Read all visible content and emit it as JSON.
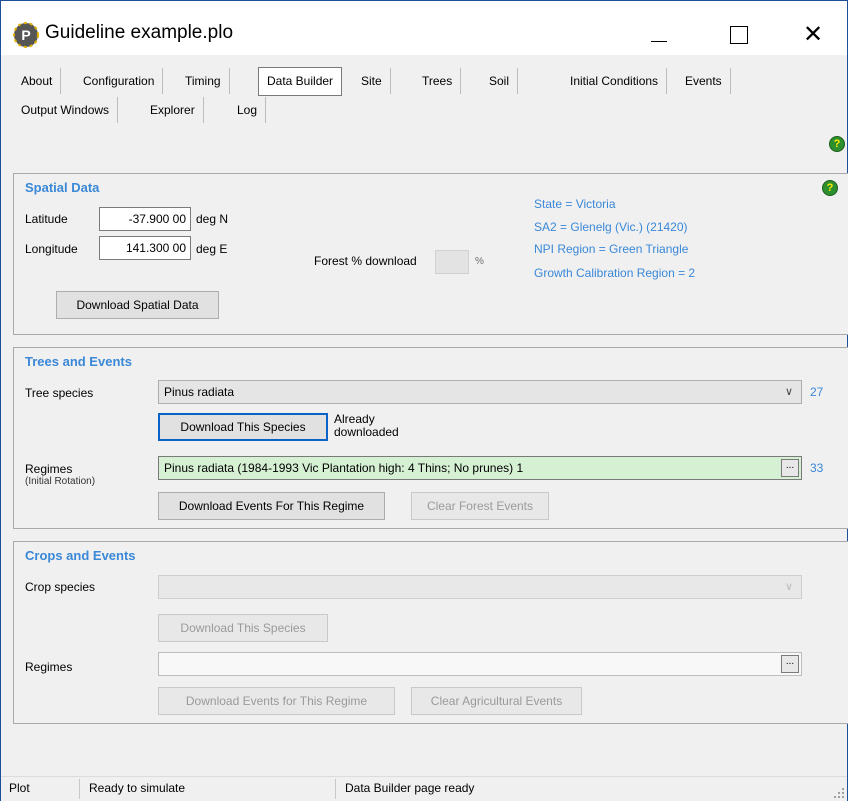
{
  "window": {
    "title": "Guideline example.plo",
    "app_icon_letter": "P",
    "min_icon": "minimize-icon",
    "max_icon": "maximize-icon",
    "close_glyph": "✕"
  },
  "tabs_row1": [
    "About",
    "Configuration",
    "Timing",
    "Data Builder",
    "Site",
    "Trees",
    "Soil",
    "Initial Conditions",
    "Events"
  ],
  "tabs_row2": [
    "Output Windows",
    "Explorer",
    "Log"
  ],
  "active_tab": "Data Builder",
  "help_glyph": "?",
  "spatial": {
    "title": "Spatial Data",
    "latitude_label": "Latitude",
    "latitude_value": "-37.900 00",
    "latitude_unit": "deg N",
    "longitude_label": "Longitude",
    "longitude_value": "141.300 00",
    "longitude_unit": "deg E",
    "forest_label": "Forest % download",
    "forest_unit": "%",
    "download_button": "Download Spatial Data",
    "info": [
      "State = Victoria",
      "SA2 = Glenelg (Vic.) (21420)",
      "NPI Region = Green Triangle",
      "Growth Calibration Region = 2"
    ]
  },
  "trees": {
    "title": "Trees and Events",
    "species_label": "Tree species",
    "species_value": "Pinus radiata",
    "species_count": "27",
    "download_species_button": "Download This Species",
    "already_downloaded": [
      "Already",
      "downloaded"
    ],
    "regimes_label": "Regimes",
    "regimes_sublabel": "(Initial Rotation)",
    "regime_value": "Pinus radiata (1984-1993 Vic Plantation high: 4 Thins; No prunes) 1",
    "regime_count": "33",
    "download_events_button": "Download Events For This Regime",
    "clear_events_button": "Clear Forest Events"
  },
  "crops": {
    "title": "Crops and Events",
    "species_label": "Crop species",
    "species_value": "",
    "download_species_button": "Download This Species",
    "regimes_label": "Regimes",
    "regime_value": "",
    "download_events_button": "Download Events for This Regime",
    "clear_events_button": "Clear Agricultural Events"
  },
  "ellipsis": "...",
  "chevron": "∨",
  "status": {
    "cell1": "Plot",
    "cell2": "Ready to simulate",
    "cell3": "Data Builder page ready"
  }
}
